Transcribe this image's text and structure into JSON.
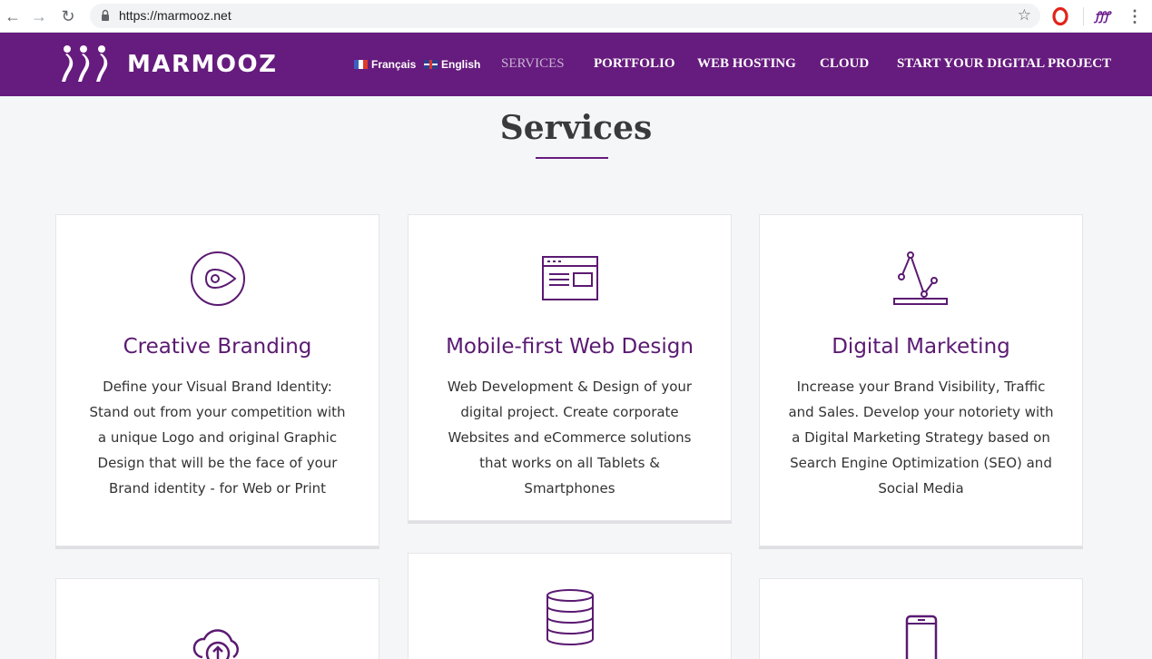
{
  "browser": {
    "url": "https://marmooz.net",
    "back_icon": "arrow-left-icon",
    "forward_icon": "arrow-right-icon",
    "reload_icon": "reload-icon",
    "bookmark_icon": "star-icon",
    "menu_icon": "vertical-dots-icon"
  },
  "header": {
    "brand": "MARMOOZ",
    "brand_color": "#661b7e",
    "languages": [
      {
        "label": "Français",
        "flag": "flag-fr-icon"
      },
      {
        "label": "English",
        "flag": "flag-uk-icon"
      }
    ],
    "nav": [
      {
        "label": "SERVICES",
        "active": true
      },
      {
        "label": "PORTFOLIO",
        "active": false
      },
      {
        "label": "WEB HOSTING",
        "active": false
      },
      {
        "label": "CLOUD",
        "active": false
      },
      {
        "label": "START YOUR DIGITAL PROJECT",
        "active": false
      }
    ]
  },
  "section": {
    "title": "Services"
  },
  "cards": [
    {
      "icon": "eye-pin-icon",
      "title": "Creative Branding",
      "description": "Define your Visual Brand Identity: Stand out from your competition with a unique Logo and original Graphic Design that will be the face of your Brand identity - for Web or Print"
    },
    {
      "icon": "browser-window-icon",
      "title": "Mobile-first Web Design",
      "description": "Web Development & Design of your digital project. Create corporate Websites and eCommerce solutions that works on all Tablets & Smartphones"
    },
    {
      "icon": "line-chart-icon",
      "title": "Digital Marketing",
      "description": "Increase your Brand Visibility, Traffic and Sales. Develop your notoriety with a Digital Marketing Strategy based on Search Engine Optimization (SEO) and Social Media"
    },
    {
      "icon": "cloud-upload-icon",
      "title": "",
      "description": ""
    },
    {
      "icon": "database-icon",
      "title": "",
      "description": ""
    },
    {
      "icon": "smartphone-icon",
      "title": "",
      "description": ""
    }
  ]
}
